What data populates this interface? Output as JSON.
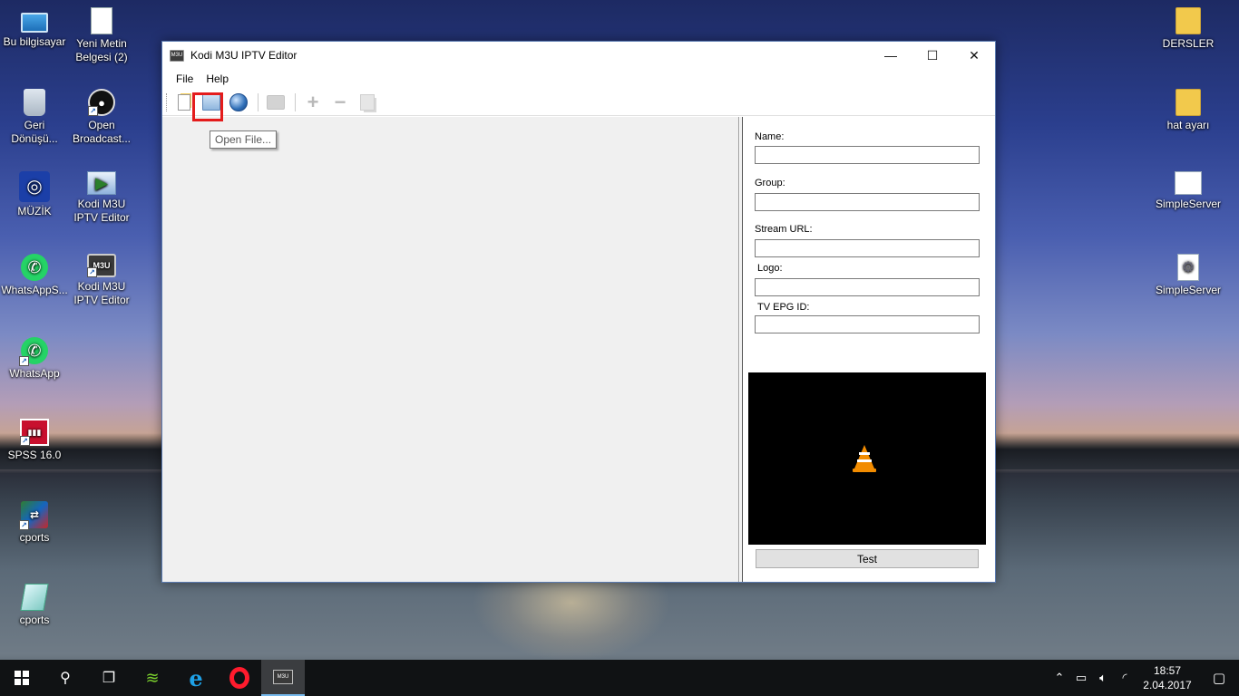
{
  "desktop": {
    "left_icons": [
      {
        "label": "Bu bilgisayar",
        "icon": "computer-icon"
      },
      {
        "label": "Yeni Metin Belgesi (2)",
        "icon": "text-document-icon"
      },
      {
        "label": "Geri Dönüşü...",
        "icon": "recycle-bin-icon"
      },
      {
        "label": "Open Broadcast...",
        "icon": "obs-icon"
      },
      {
        "label": "MÜZİK",
        "icon": "music-icon"
      },
      {
        "label": "Kodi M3U IPTV Editor",
        "icon": "kodi-editor-icon"
      },
      {
        "label": "WhatsAppS...",
        "icon": "whatsapp-icon"
      },
      {
        "label": "Kodi M3U IPTV Editor",
        "icon": "m3u-icon"
      },
      {
        "label": "WhatsApp",
        "icon": "whatsapp-icon"
      },
      {
        "label": "SPSS 16.0",
        "icon": "spss-icon"
      },
      {
        "label": "cports",
        "icon": "cports-icon"
      },
      {
        "label": "cports",
        "icon": "cports-folder-icon"
      }
    ],
    "right_icons": [
      {
        "label": "DERSLER",
        "icon": "folder-icon"
      },
      {
        "label": "hat ayarı",
        "icon": "folder-icon"
      },
      {
        "label": "SimpleServer",
        "icon": "simpleserver-icon"
      },
      {
        "label": "SimpleServer",
        "icon": "simpleserver-config-icon"
      }
    ]
  },
  "window": {
    "title": "Kodi M3U IPTV Editor",
    "app_icon_text": "M3U",
    "controls": {
      "minimize": "—",
      "maximize": "☐",
      "close": "✕"
    },
    "menu": [
      "File",
      "Help"
    ],
    "toolbar": {
      "buttons": [
        "new-file",
        "open-file",
        "web",
        "upload",
        "add",
        "remove",
        "duplicate"
      ],
      "tooltip": "Open File..."
    },
    "details": {
      "name_label": "Name:",
      "name_value": "",
      "group_label": "Group:",
      "group_value": "",
      "stream_url_label": "Stream URL:",
      "stream_url_value": "",
      "logo_label": "Logo:",
      "logo_value": "",
      "epg_label": "TV EPG ID:",
      "epg_value": "",
      "test_button": "Test"
    }
  },
  "taskbar": {
    "clock_time": "18:57",
    "clock_date": "2.04.2017",
    "m3u_text": "M3U"
  },
  "colors": {
    "highlight": "#e41c1c",
    "accent": "#76b9ed"
  }
}
